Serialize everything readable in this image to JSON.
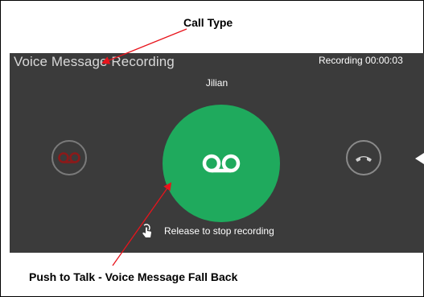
{
  "annotations": {
    "top_label": "Call Type",
    "bottom_label": "Push to Talk - Voice Message Fall Back"
  },
  "call": {
    "title": "Voice Message Recording",
    "status": "Recording 00:00:03",
    "contact_name": "Jilian",
    "hint": "Release to stop recording"
  },
  "icons": {
    "left_button": "voicemail-icon",
    "center_button": "voicemail-icon",
    "right_button": "hang-up-icon",
    "hint": "touch-icon",
    "edge": "arrow-left-icon"
  },
  "colors": {
    "background": "#3b3b3b",
    "ptt_green": "#1faa5d",
    "voicemail_red": "#8b1a1a",
    "callout_arrow": "#e8141c"
  }
}
